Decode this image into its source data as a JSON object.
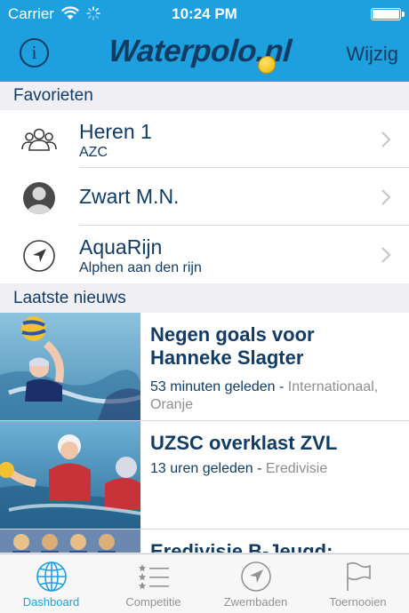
{
  "status_bar": {
    "carrier": "Carrier",
    "time": "10:24 PM"
  },
  "nav": {
    "info_label": "i",
    "logo_text": "Waterpolo.nl",
    "edit_label": "Wijzig"
  },
  "favorites": {
    "header": "Favorieten",
    "items": [
      {
        "title": "Heren 1",
        "subtitle": "AZC",
        "icon": "team-icon"
      },
      {
        "title": "Zwart M.N.",
        "subtitle": "",
        "icon": "person-icon"
      },
      {
        "title": "AquaRijn",
        "subtitle": "Alphen aan den rijn",
        "icon": "location-arrow-icon"
      }
    ]
  },
  "news": {
    "header": "Laatste nieuws",
    "items": [
      {
        "headline": "Negen goals voor Hanneke Slagter",
        "time": "53 minuten geleden",
        "category": "Internationaal, Oranje"
      },
      {
        "headline": "UZSC overklast ZVL",
        "time": "13 uren geleden",
        "category": "Eredivisie"
      },
      {
        "headline": "Eredivisie B-Jeugd:",
        "time": "",
        "category": ""
      }
    ]
  },
  "tabbar": {
    "tabs": [
      {
        "label": "Dashboard",
        "icon": "globe-icon",
        "active": true
      },
      {
        "label": "Competitie",
        "icon": "star-list-icon",
        "active": false
      },
      {
        "label": "Zwembaden",
        "icon": "compass-arrow-icon",
        "active": false
      },
      {
        "label": "Toernooien",
        "icon": "flag-icon",
        "active": false
      }
    ]
  },
  "colors": {
    "nav_bar": "#1fa0de",
    "text_primary": "#123c63",
    "active_tab": "#1fa0de",
    "inactive_tab": "#929292"
  }
}
